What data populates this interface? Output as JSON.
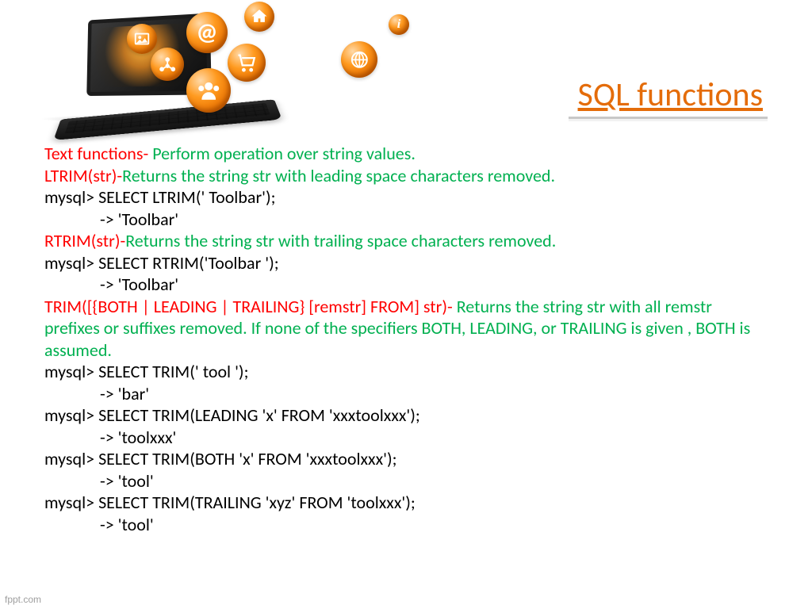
{
  "title": "SQL functions",
  "watermark": "fppt.com",
  "lines": {
    "l1a": "Text functions-",
    "l1b": " Perform operation over string values.",
    "l2a": "LTRIM(str)-",
    "l2b": "Returns the string str with leading space characters removed.",
    "l3": "mysql> SELECT LTRIM(' Toolbar');",
    "l4": "-> 'Toolbar'",
    "l5a": "RTRIM(str)-",
    "l5b": "Returns the string str with trailing space characters removed.",
    "l6": "mysql> SELECT RTRIM('Toolbar    ');",
    "l7": "-> 'Toolbar'",
    "l8a": "TRIM([{BOTH | LEADING | TRAILING} [remstr] FROM] str)-",
    "l8b": " Returns the string str with all remstr prefixes or suffixes removed. If none of the specifiers BOTH, LEADING, or TRAILING is given , BOTH is assumed.",
    "l9": "mysql> SELECT TRIM('  tool   ');",
    "l10": "-> 'bar'",
    "l11": "mysql> SELECT TRIM(LEADING 'x' FROM 'xxxtoolxxx');",
    "l12": "-> 'toolxxx'",
    "l13": "mysql> SELECT TRIM(BOTH 'x' FROM 'xxxtoolxxx');",
    "l14": "-> 'tool'",
    "l15": "mysql> SELECT TRIM(TRAILING 'xyz' FROM 'toolxxx');",
    "l16": "-> 'tool'"
  }
}
